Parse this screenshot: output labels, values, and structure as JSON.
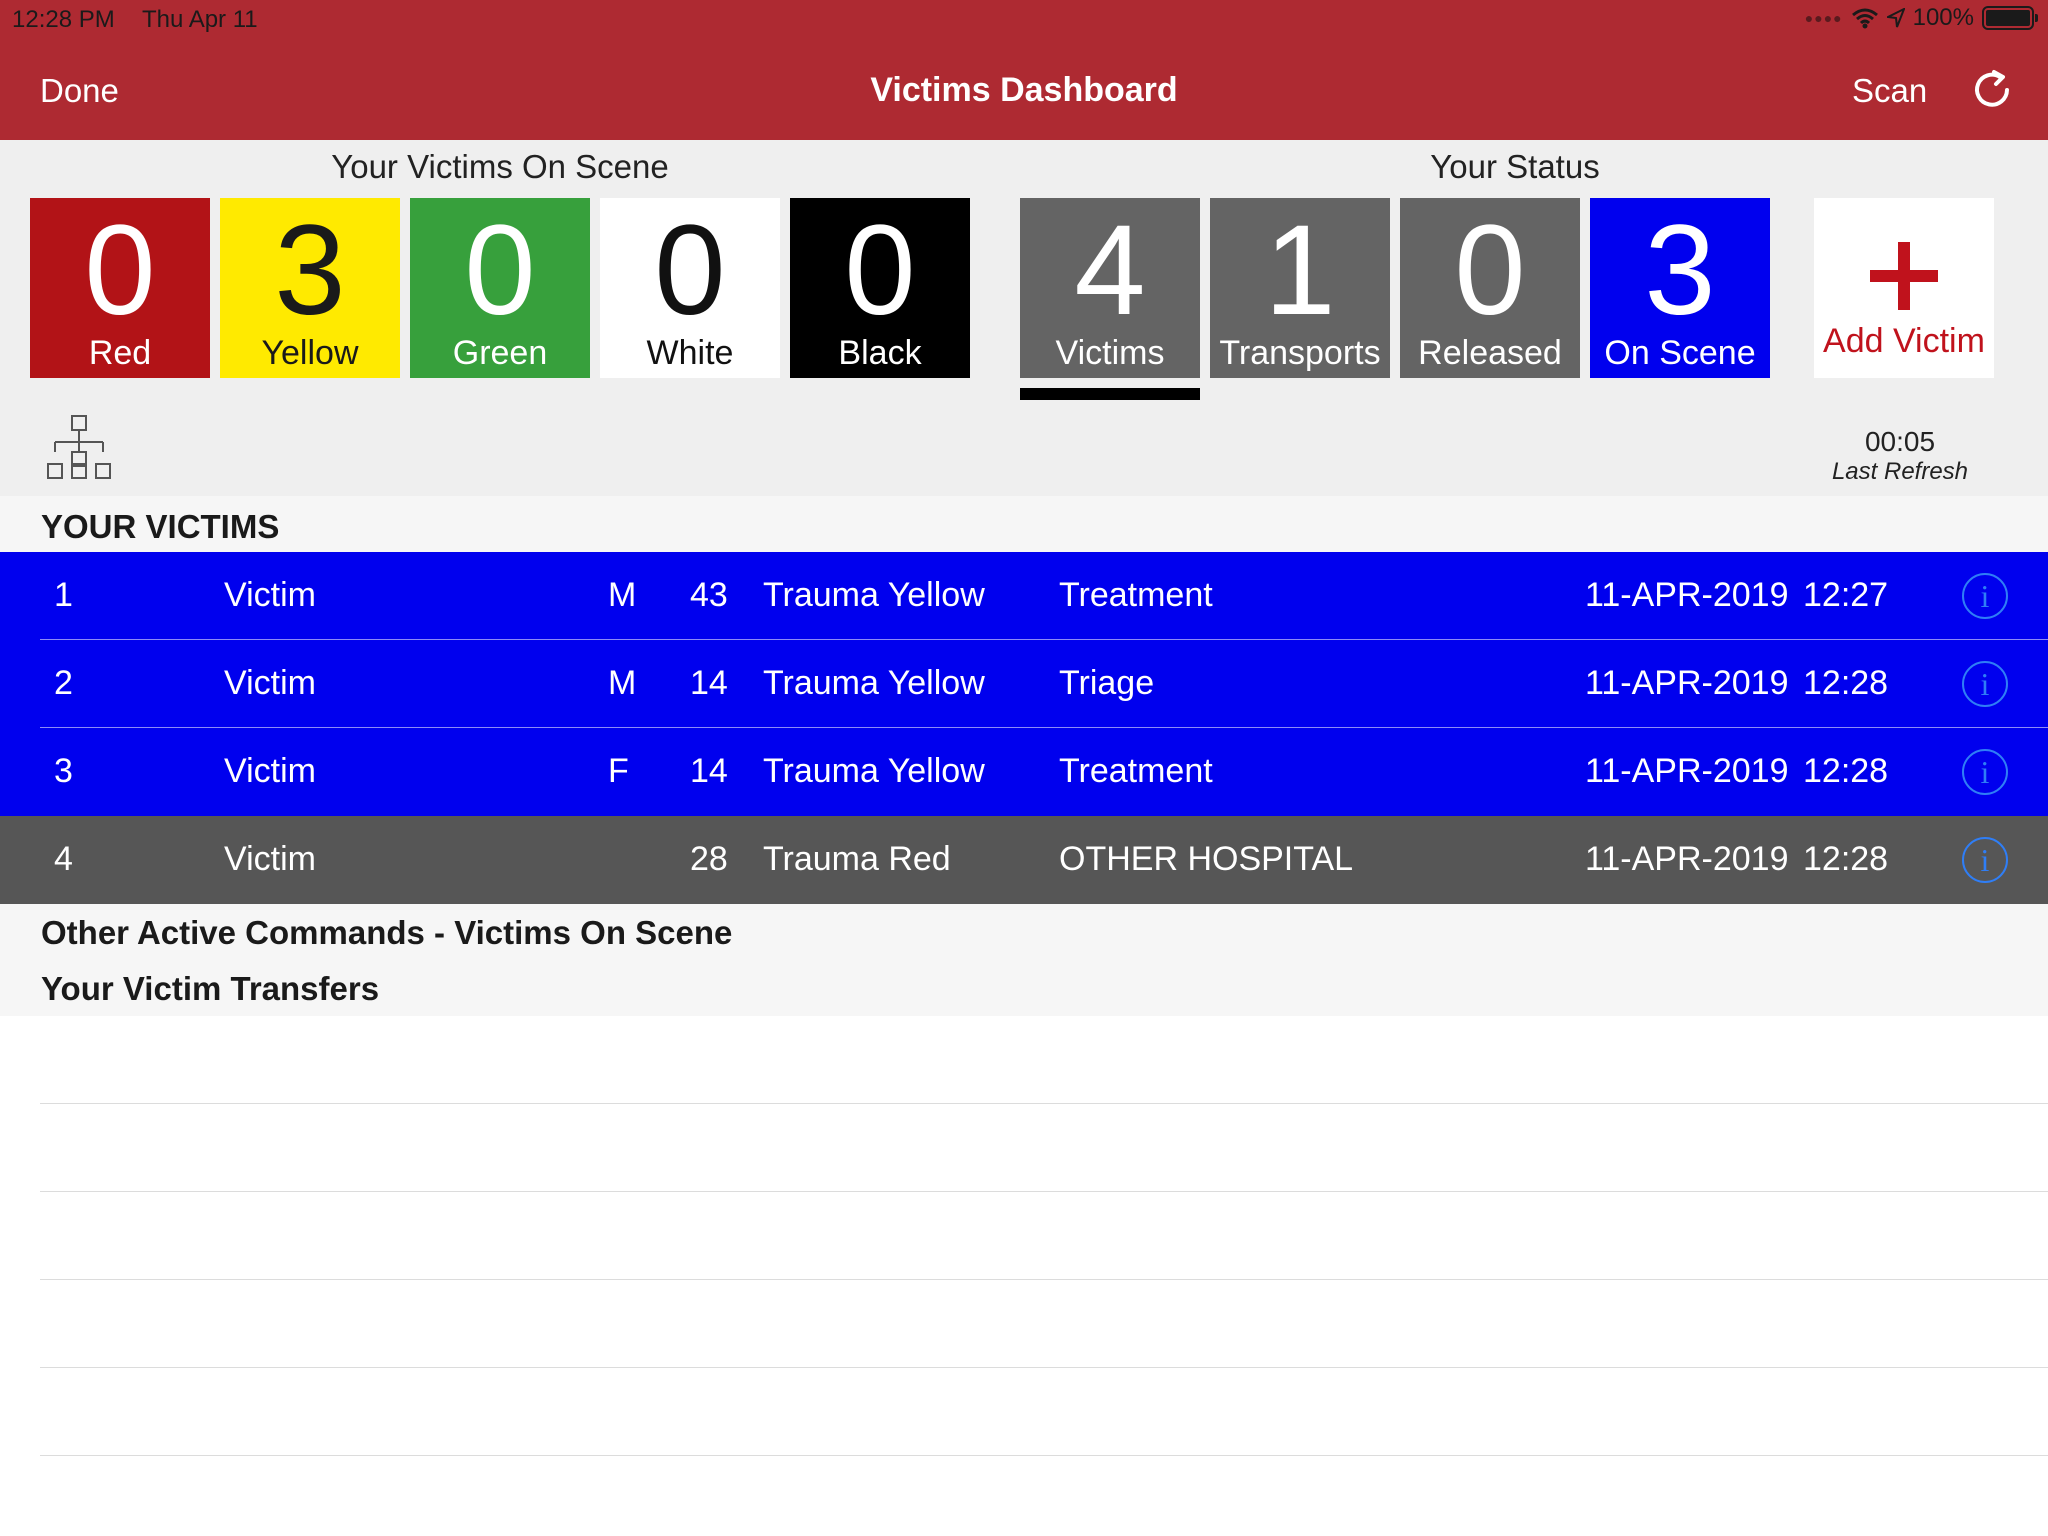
{
  "status_bar": {
    "time": "12:28 PM",
    "date": "Thu Apr 11",
    "battery": "100%"
  },
  "nav": {
    "done_label": "Done",
    "title": "Victims Dashboard",
    "scan_label": "Scan"
  },
  "on_scene": {
    "heading": "Your Victims On Scene",
    "tiles": [
      {
        "count": "0",
        "label": "Red"
      },
      {
        "count": "3",
        "label": "Yellow"
      },
      {
        "count": "0",
        "label": "Green"
      },
      {
        "count": "0",
        "label": "White"
      },
      {
        "count": "0",
        "label": "Black"
      }
    ]
  },
  "status": {
    "heading": "Your Status",
    "tiles": [
      {
        "count": "4",
        "label": "Victims"
      },
      {
        "count": "1",
        "label": "Transports"
      },
      {
        "count": "0",
        "label": "Released"
      },
      {
        "count": "3",
        "label": "On Scene"
      }
    ],
    "selected": "Victims",
    "add_label": "Add Victim"
  },
  "refresh": {
    "time": "00:05",
    "label": "Last Refresh"
  },
  "victims": {
    "heading": "YOUR VICTIMS",
    "rows": [
      {
        "id": "1",
        "name": "Victim",
        "sex": "M",
        "age": "43",
        "category": "Trauma Yellow",
        "status": "Treatment",
        "date": "11-APR-2019",
        "time": "12:27"
      },
      {
        "id": "2",
        "name": "Victim",
        "sex": "M",
        "age": "14",
        "category": "Trauma Yellow",
        "status": "Triage",
        "date": "11-APR-2019",
        "time": "12:28"
      },
      {
        "id": "3",
        "name": "Victim",
        "sex": "F",
        "age": "14",
        "category": "Trauma Yellow",
        "status": "Treatment",
        "date": "11-APR-2019",
        "time": "12:28"
      },
      {
        "id": "4",
        "name": "Victim",
        "sex": "",
        "age": "28",
        "category": "Trauma Red",
        "status": "OTHER HOSPITAL",
        "date": "11-APR-2019",
        "time": "12:28"
      }
    ],
    "info_glyph": "i"
  },
  "other_commands": {
    "heading": "Other Active Commands - Victims On Scene"
  },
  "transfers": {
    "heading": "Your Victim Transfers"
  },
  "colors": {
    "header_red": "#ae2a32",
    "row_blue": "#0000ee",
    "row_gray": "#565656",
    "info_blue": "#2f7ef6"
  },
  "icons": [
    "wifi-icon",
    "location-arrow-icon",
    "battery-icon",
    "refresh-icon",
    "hierarchy-icon",
    "info-icon",
    "plus-icon"
  ]
}
